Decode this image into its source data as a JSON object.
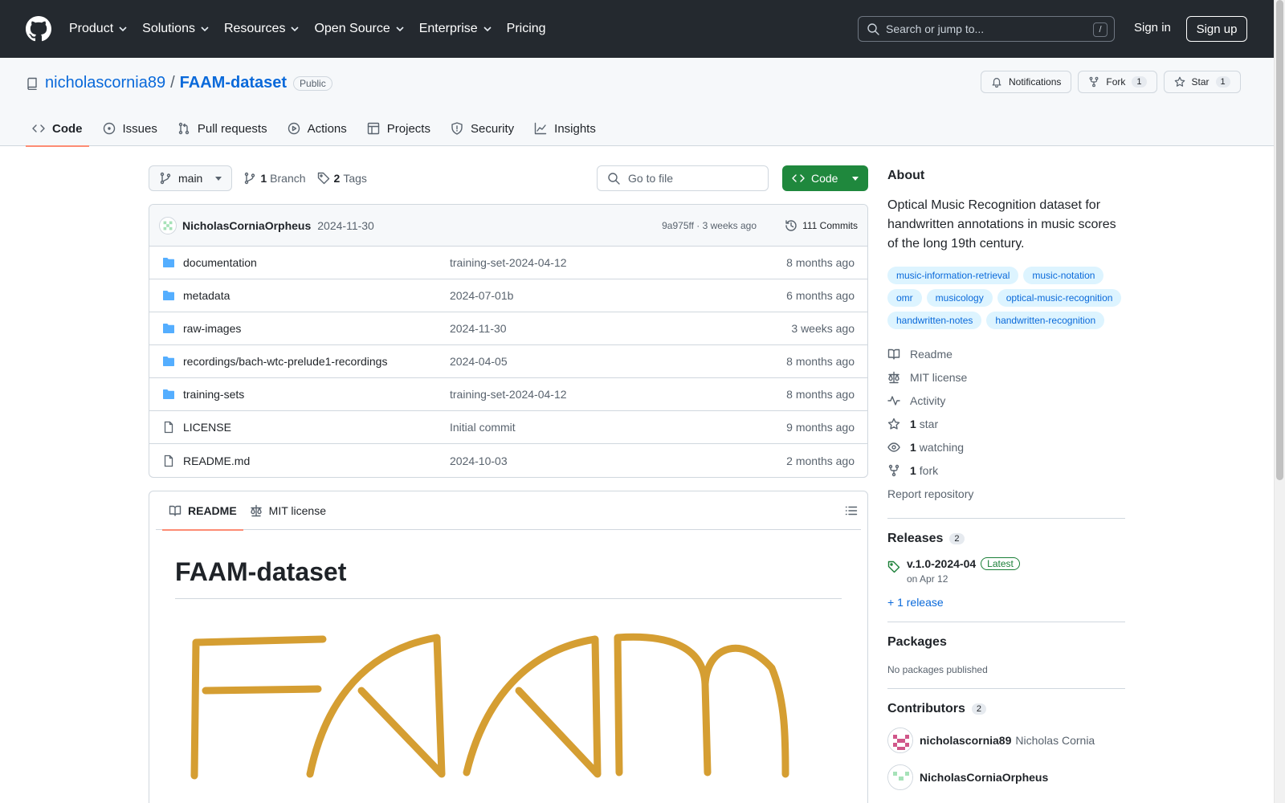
{
  "header": {
    "nav": [
      {
        "label": "Product",
        "has_menu": true
      },
      {
        "label": "Solutions",
        "has_menu": true
      },
      {
        "label": "Resources",
        "has_menu": true
      },
      {
        "label": "Open Source",
        "has_menu": true
      },
      {
        "label": "Enterprise",
        "has_menu": true
      },
      {
        "label": "Pricing",
        "has_menu": false
      }
    ],
    "search_placeholder": "Search or jump to...",
    "search_key": "/",
    "sign_in": "Sign in",
    "sign_up": "Sign up"
  },
  "repo": {
    "owner": "nicholascornia89",
    "separator": "/",
    "name": "FAAM-dataset",
    "visibility": "Public",
    "notifications_label": "Notifications",
    "fork_label": "Fork",
    "fork_count": "1",
    "star_label": "Star",
    "star_count": "1"
  },
  "tabs": [
    {
      "label": "Code",
      "icon": "code-icon",
      "active": true
    },
    {
      "label": "Issues",
      "icon": "issue-icon",
      "active": false
    },
    {
      "label": "Pull requests",
      "icon": "pull-request-icon",
      "active": false
    },
    {
      "label": "Actions",
      "icon": "play-icon",
      "active": false
    },
    {
      "label": "Projects",
      "icon": "table-icon",
      "active": false
    },
    {
      "label": "Security",
      "icon": "shield-icon",
      "active": false
    },
    {
      "label": "Insights",
      "icon": "graph-icon",
      "active": false
    }
  ],
  "file_nav": {
    "branch": "main",
    "branch_count": "1",
    "branch_label": "Branch",
    "tag_count": "2",
    "tag_label": "Tags",
    "goto_placeholder": "Go to file",
    "code_button": "Code"
  },
  "latest_commit": {
    "author": "NicholasCorniaOrpheus",
    "message": "2024-11-30",
    "meta": "9a975ff · 3 weeks ago",
    "commits": "111 Commits"
  },
  "files": [
    {
      "type": "dir",
      "name": "documentation",
      "message": "training-set-2024-04-12",
      "age": "8 months ago"
    },
    {
      "type": "dir",
      "name": "metadata",
      "message": "2024-07-01b",
      "age": "6 months ago"
    },
    {
      "type": "dir",
      "name": "raw-images",
      "message": "2024-11-30",
      "age": "3 weeks ago"
    },
    {
      "type": "dir",
      "name": "recordings/bach-wtc-prelude1-recordings",
      "message": "2024-04-05",
      "age": "8 months ago"
    },
    {
      "type": "dir",
      "name": "training-sets",
      "message": "training-set-2024-04-12",
      "age": "8 months ago"
    },
    {
      "type": "file",
      "name": "LICENSE",
      "message": "Initial commit",
      "age": "9 months ago"
    },
    {
      "type": "file",
      "name": "README.md",
      "message": "2024-10-03",
      "age": "2 months ago"
    }
  ],
  "readme": {
    "tab_readme": "README",
    "tab_license": "MIT license",
    "title": "FAAM-dataset",
    "logo_text": "FAAM",
    "logo_color": "#d59e32"
  },
  "about": {
    "heading": "About",
    "description": "Optical Music Recognition dataset for handwritten annotations in music scores of the long 19th century.",
    "topics": [
      "music-information-retrieval",
      "music-notation",
      "omr",
      "musicology",
      "optical-music-recognition",
      "handwritten-notes",
      "handwritten-recognition"
    ],
    "links": [
      {
        "icon": "book-icon",
        "count": "",
        "label": "Readme"
      },
      {
        "icon": "law-icon",
        "count": "",
        "label": "MIT license"
      },
      {
        "icon": "pulse-icon",
        "count": "",
        "label": "Activity"
      },
      {
        "icon": "star-icon",
        "count": "1",
        "label": "star"
      },
      {
        "icon": "eye-icon",
        "count": "1",
        "label": "watching"
      },
      {
        "icon": "fork-icon",
        "count": "1",
        "label": "fork"
      }
    ],
    "report": "Report repository"
  },
  "releases": {
    "heading": "Releases",
    "count": "2",
    "latest_name": "v.1.0-2024-04",
    "latest_badge": "Latest",
    "latest_date": "on Apr 12",
    "more": "+ 1 release"
  },
  "packages": {
    "heading": "Packages",
    "empty": "No packages published"
  },
  "contributors": {
    "heading": "Contributors",
    "count": "2",
    "people": [
      {
        "login": "nicholascornia89",
        "name": "Nicholas Cornia"
      },
      {
        "login": "NicholasCorniaOrpheus",
        "name": ""
      }
    ]
  },
  "colors": {
    "header_bg": "#24292f",
    "link": "#0969da",
    "green_button": "#1f883d",
    "tab_underline": "#fd8c73",
    "folder": "#54aeff"
  }
}
